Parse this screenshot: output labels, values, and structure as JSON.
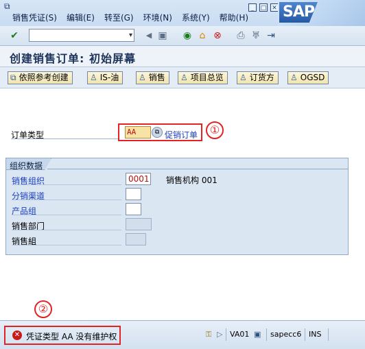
{
  "menubar": {
    "items": [
      "销售凭证(S)",
      "编辑(E)",
      "转至(G)",
      "环境(N)",
      "系统(Y)",
      "帮助(H)"
    ],
    "logo": "SAP"
  },
  "toolbar": {
    "command_value": ""
  },
  "title": "创建销售订单: 初始屏幕",
  "app_toolbar": {
    "buttons": [
      "依照参考创建",
      "IS-油",
      "销售",
      "项目总览",
      "订货方",
      "OGSD"
    ]
  },
  "order_type": {
    "label": "订单类型",
    "value": "AA",
    "description": "促销订单"
  },
  "org_data": {
    "title": "组织数据",
    "sales_org": {
      "label": "销售组织",
      "value": "0001",
      "description": "销售机构 001"
    },
    "distribution_channel": {
      "label": "分销渠道",
      "value": ""
    },
    "division": {
      "label": "产品组",
      "value": ""
    },
    "sales_office": {
      "label": "销售部门",
      "value": ""
    },
    "sales_group": {
      "label": "销售組",
      "value": ""
    }
  },
  "markers": {
    "one": "①",
    "two": "②"
  },
  "status": {
    "message": "凭证类型 AA 没有维护权",
    "transaction": "VA01",
    "server": "sapecc6",
    "mode": "INS"
  },
  "colors": {
    "error": "#e32323",
    "required_label": "#1a3fbd",
    "background": "#dbe6f3"
  }
}
